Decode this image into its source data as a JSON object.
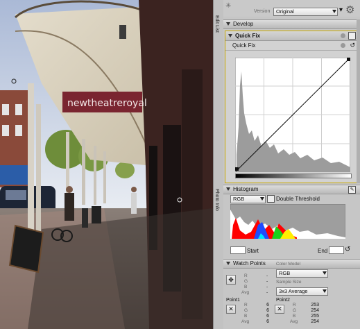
{
  "panel": {
    "version_label": "Version",
    "version_value": "Original",
    "develop_label": "Develop",
    "quickfix_title": "Quick Fix",
    "quickfix_sub": "Quick Fix",
    "histogram_label": "Histogram",
    "channel_value": "RGB",
    "double_threshold": "Double Threshold",
    "start_label": "Start",
    "end_label": "End",
    "watch_points_label": "Watch Points",
    "color_model_label": "Color Model",
    "color_model_value": "RGB",
    "sample_size_label": "Sample Size",
    "sample_size_value": "3x3 Average",
    "point1_label": "Point1",
    "point2_label": "Point2",
    "channel_letters": [
      "R",
      "G",
      "B",
      "Avg"
    ],
    "point1_values": [
      "6",
      "6",
      "6",
      "6"
    ],
    "point2_values": [
      "253",
      "254",
      "255",
      "254"
    ],
    "dashes": [
      "-",
      "-",
      "-",
      "-"
    ]
  },
  "sidebar_tabs": {
    "edit_list": "Edit List",
    "photo_info": "Photo Info"
  },
  "photo": {
    "sign_text": "newtheatreroyal"
  },
  "colors": {
    "panel_bg": "#c6c6c6",
    "accent_header": "#b5b5b5",
    "sign_bg": "#7a2530"
  }
}
